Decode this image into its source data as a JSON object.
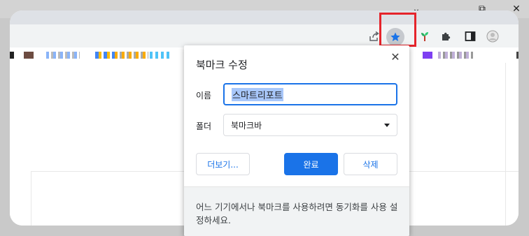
{
  "window_controls": {
    "minimize_glyph": "⌄",
    "maximize_glyph": "⧉",
    "close_glyph": "✕"
  },
  "toolbar": {
    "icons": [
      "share-icon",
      "star-icon",
      "extension-sprout-icon",
      "puzzle-extensions-icon",
      "side-panel-icon",
      "profile-avatar-icon"
    ]
  },
  "colors": {
    "accent": "#1a73e8",
    "highlight_border": "#e5242b",
    "star_fill": "#1a73e8",
    "selection": "#a8c7fa"
  },
  "dialog": {
    "title": "북마크 수정",
    "close_glyph": "✕",
    "name_label": "이름",
    "name_value": "스마트리포트",
    "folder_label": "폴더",
    "folder_value": "북마크바",
    "more_button": "더보기...",
    "done_button": "완료",
    "delete_button": "삭제",
    "footer_text": "어느 기기에서나 북마크를 사용하려면 동기화를 사용 설정하세요."
  }
}
